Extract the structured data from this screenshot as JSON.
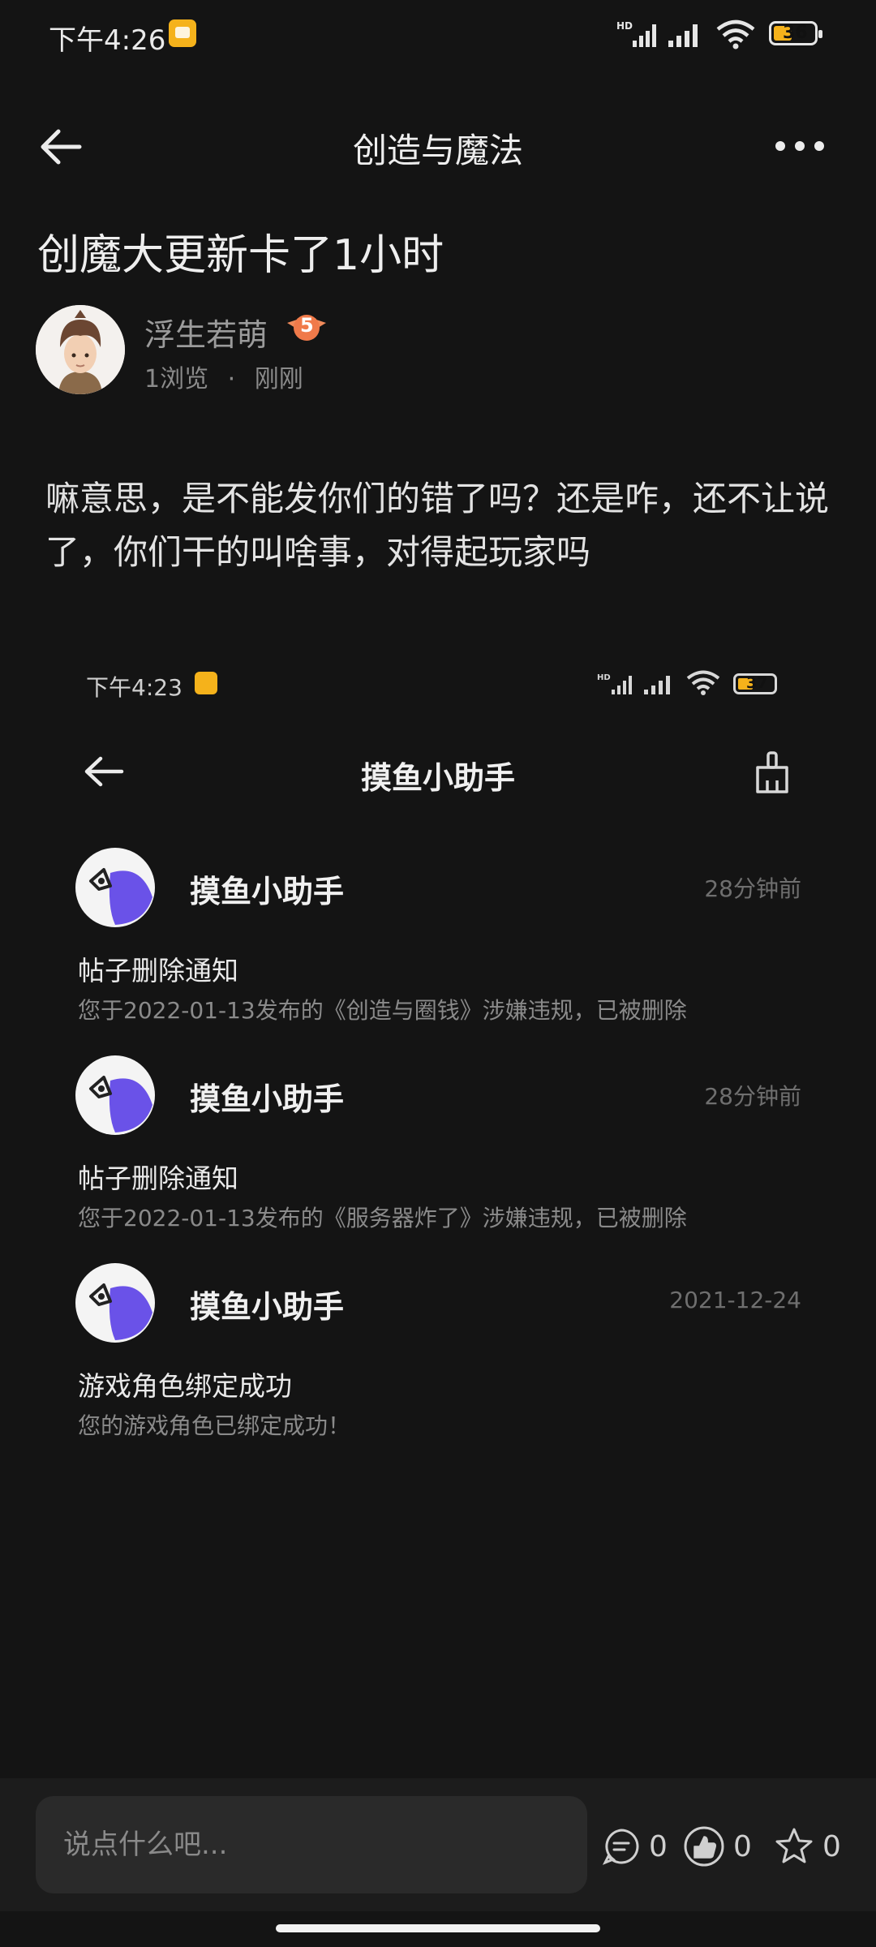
{
  "status_bar": {
    "time": "下午4:26",
    "battery": "36"
  },
  "nav": {
    "title": "创造与魔法"
  },
  "post": {
    "title": "创魔大更新卡了1小时",
    "author": "浮生若萌",
    "level": "5",
    "views": "1浏览",
    "separator": "·",
    "posted": "刚刚",
    "body": "嘛意思，是不能发你们的错了吗？还是咋，还不让说了，你们干的叫啥事，对得起玩家吗"
  },
  "screenshot": {
    "status_time": "下午4:23",
    "battery": "37",
    "title": "摸鱼小助手",
    "messages": [
      {
        "sender": "摸鱼小助手",
        "time": "28分钟前",
        "title": "帖子删除通知",
        "body": "您于2022-01-13发布的《创造与圈钱》涉嫌违规，已被删除"
      },
      {
        "sender": "摸鱼小助手",
        "time": "28分钟前",
        "title": "帖子删除通知",
        "body": "您于2022-01-13发布的《服务器炸了》涉嫌违规，已被删除"
      },
      {
        "sender": "摸鱼小助手",
        "time": "2021-12-24",
        "title": "游戏角色绑定成功",
        "body": "您的游戏角色已绑定成功！"
      }
    ]
  },
  "bottom": {
    "comment_placeholder": "说点什么吧...",
    "comment_count": "0",
    "like_count": "0",
    "favorite_count": "0"
  },
  "colors": {
    "background": "#141414",
    "accent": "#f5b21b",
    "logo_purple": "#6a52e8"
  }
}
